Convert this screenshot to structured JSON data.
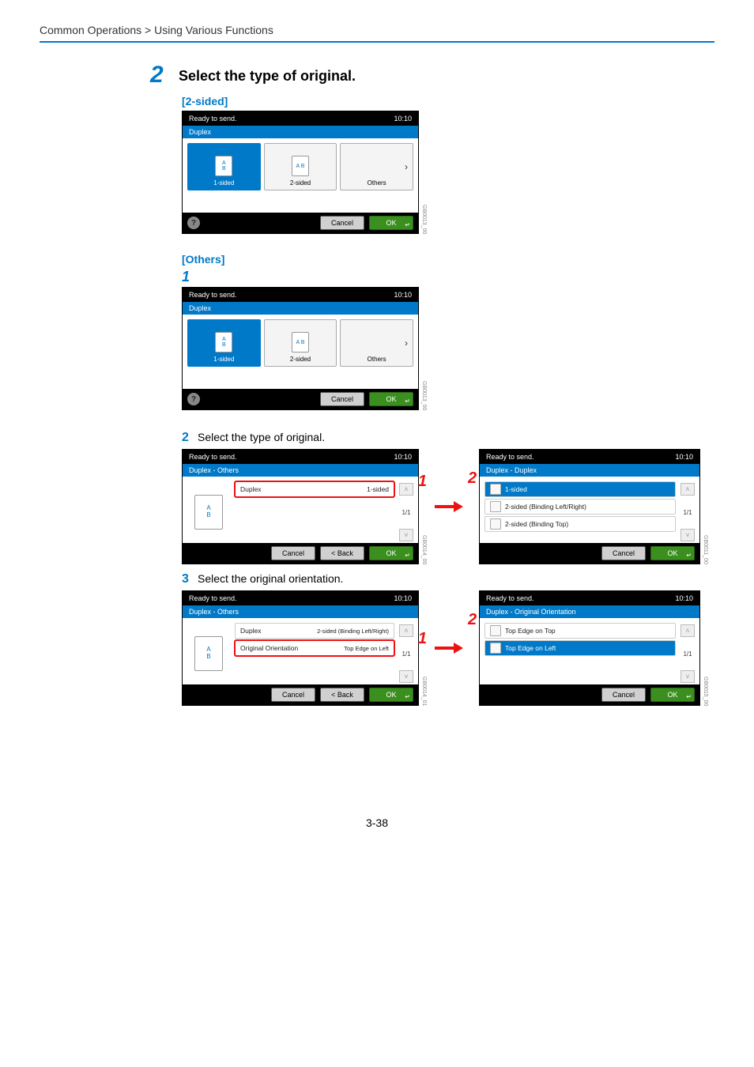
{
  "breadcrumb": "Common Operations > Using Various Functions",
  "pageNumber": "3-38",
  "step": {
    "number": "2",
    "title": "Select the type of original.",
    "twoSidedHead": "[2-sided]",
    "othersHead": "[Others]"
  },
  "sub": {
    "one": "1",
    "two": {
      "num": "2",
      "text": "Select the type of original."
    },
    "three": {
      "num": "3",
      "text": "Select the original orientation."
    }
  },
  "panelA": {
    "status": "Ready to send.",
    "clock": "10:10",
    "crumb": "Duplex",
    "tiles": {
      "t1": "1-sided",
      "t2": "2-sided",
      "t3": "Others"
    },
    "cancel": "Cancel",
    "ok": "OK",
    "ref": "GB0013_00"
  },
  "panelB": {
    "status": "Ready to send.",
    "clock": "10:10",
    "crumb": "Duplex",
    "tiles": {
      "t1": "1-sided",
      "t2": "2-sided",
      "t3": "Others"
    },
    "cancel": "Cancel",
    "ok": "OK",
    "ref": "GB0013_00"
  },
  "panelC": {
    "status": "Ready to send.",
    "clock": "10:10",
    "crumb": "Duplex - Others",
    "row1": {
      "label": "Duplex",
      "value": "1-sided"
    },
    "page": "1/1",
    "cancel": "Cancel",
    "back": "< Back",
    "ok": "OK",
    "ref": "GB0014_00",
    "callout": "1"
  },
  "panelD": {
    "status": "Ready to send.",
    "clock": "10:10",
    "crumb": "Duplex - Duplex",
    "r1": "1-sided",
    "r2": "2-sided (Binding Left/Right)",
    "r3": "2-sided (Binding Top)",
    "page": "1/1",
    "cancel": "Cancel",
    "ok": "OK",
    "ref": "GB0011_00",
    "callout": "2"
  },
  "panelE": {
    "status": "Ready to send.",
    "clock": "10:10",
    "crumb": "Duplex - Others",
    "row1": {
      "label": "Duplex",
      "value": "2-sided (Binding Left/Right)"
    },
    "row2": {
      "label": "Original Orientation",
      "value": "Top Edge on Left"
    },
    "page": "1/1",
    "cancel": "Cancel",
    "back": "< Back",
    "ok": "OK",
    "ref": "GB0014_01",
    "callout": "1"
  },
  "panelF": {
    "status": "Ready to send.",
    "clock": "10:10",
    "crumb": "Duplex - Original Orientation",
    "r1": "Top Edge on Top",
    "r2": "Top Edge on Left",
    "page": "1/1",
    "cancel": "Cancel",
    "ok": "OK",
    "ref": "GB0015_00",
    "callout": "2"
  }
}
